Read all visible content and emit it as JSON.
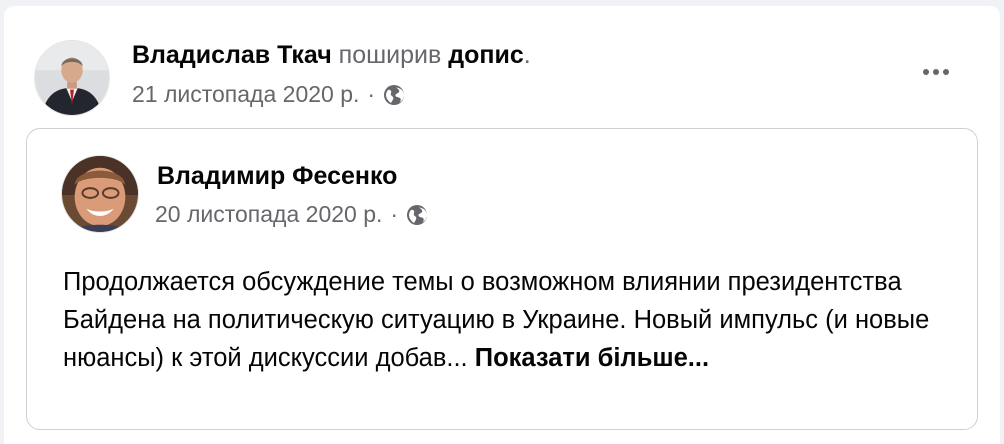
{
  "post": {
    "author": "Владислав Ткач",
    "verb": "поширив",
    "object": "допис",
    "period": ".",
    "date": "21 листопада 2020 р.",
    "separator": "·",
    "privacy_icon": "globe-icon",
    "menu_icon": "more-options-icon"
  },
  "shared_post": {
    "author": "Владимир Фесенко",
    "date": "20 листопада 2020 р.",
    "separator": "·",
    "privacy_icon": "globe-icon",
    "text": "Продолжается обсуждение темы о возможном влиянии президентства Байдена на политическую ситуацию в Украине. Новый импульс (и новые нюансы) к этой дискуссии добав...",
    "see_more": "Показати більше..."
  },
  "colors": {
    "background": "#f0f2f5",
    "card": "#ffffff",
    "primary_text": "#050505",
    "secondary_text": "#65676b",
    "border": "#ced0d4"
  }
}
